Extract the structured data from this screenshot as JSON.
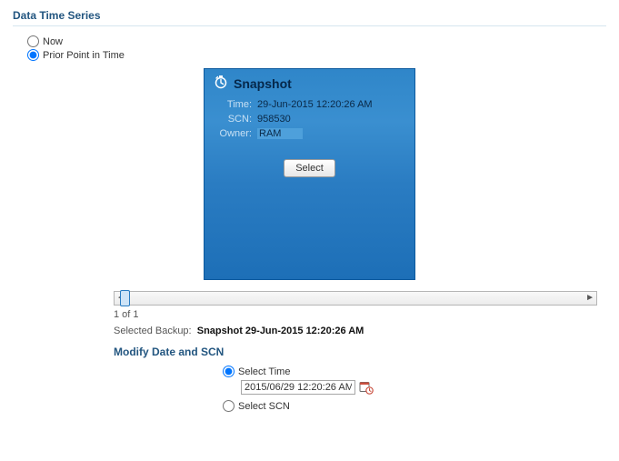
{
  "section_title": "Data Time Series",
  "point_options": {
    "now": "Now",
    "prior": "Prior Point in Time"
  },
  "snapshot": {
    "title": "Snapshot",
    "labels": {
      "time": "Time:",
      "scn": "SCN:",
      "owner": "Owner:"
    },
    "time": "29-Jun-2015 12:20:26 AM",
    "scn": "958530",
    "owner": "RAM",
    "select_label": "Select"
  },
  "pager": "1 of 1",
  "selected_backup": {
    "label": "Selected Backup:",
    "value": "Snapshot  29-Jun-2015 12:20:26 AM"
  },
  "modify": {
    "title": "Modify Date and SCN",
    "select_time": "Select Time",
    "select_scn": "Select SCN",
    "datetime_value": "2015/06/29 12:20:26 AM"
  }
}
